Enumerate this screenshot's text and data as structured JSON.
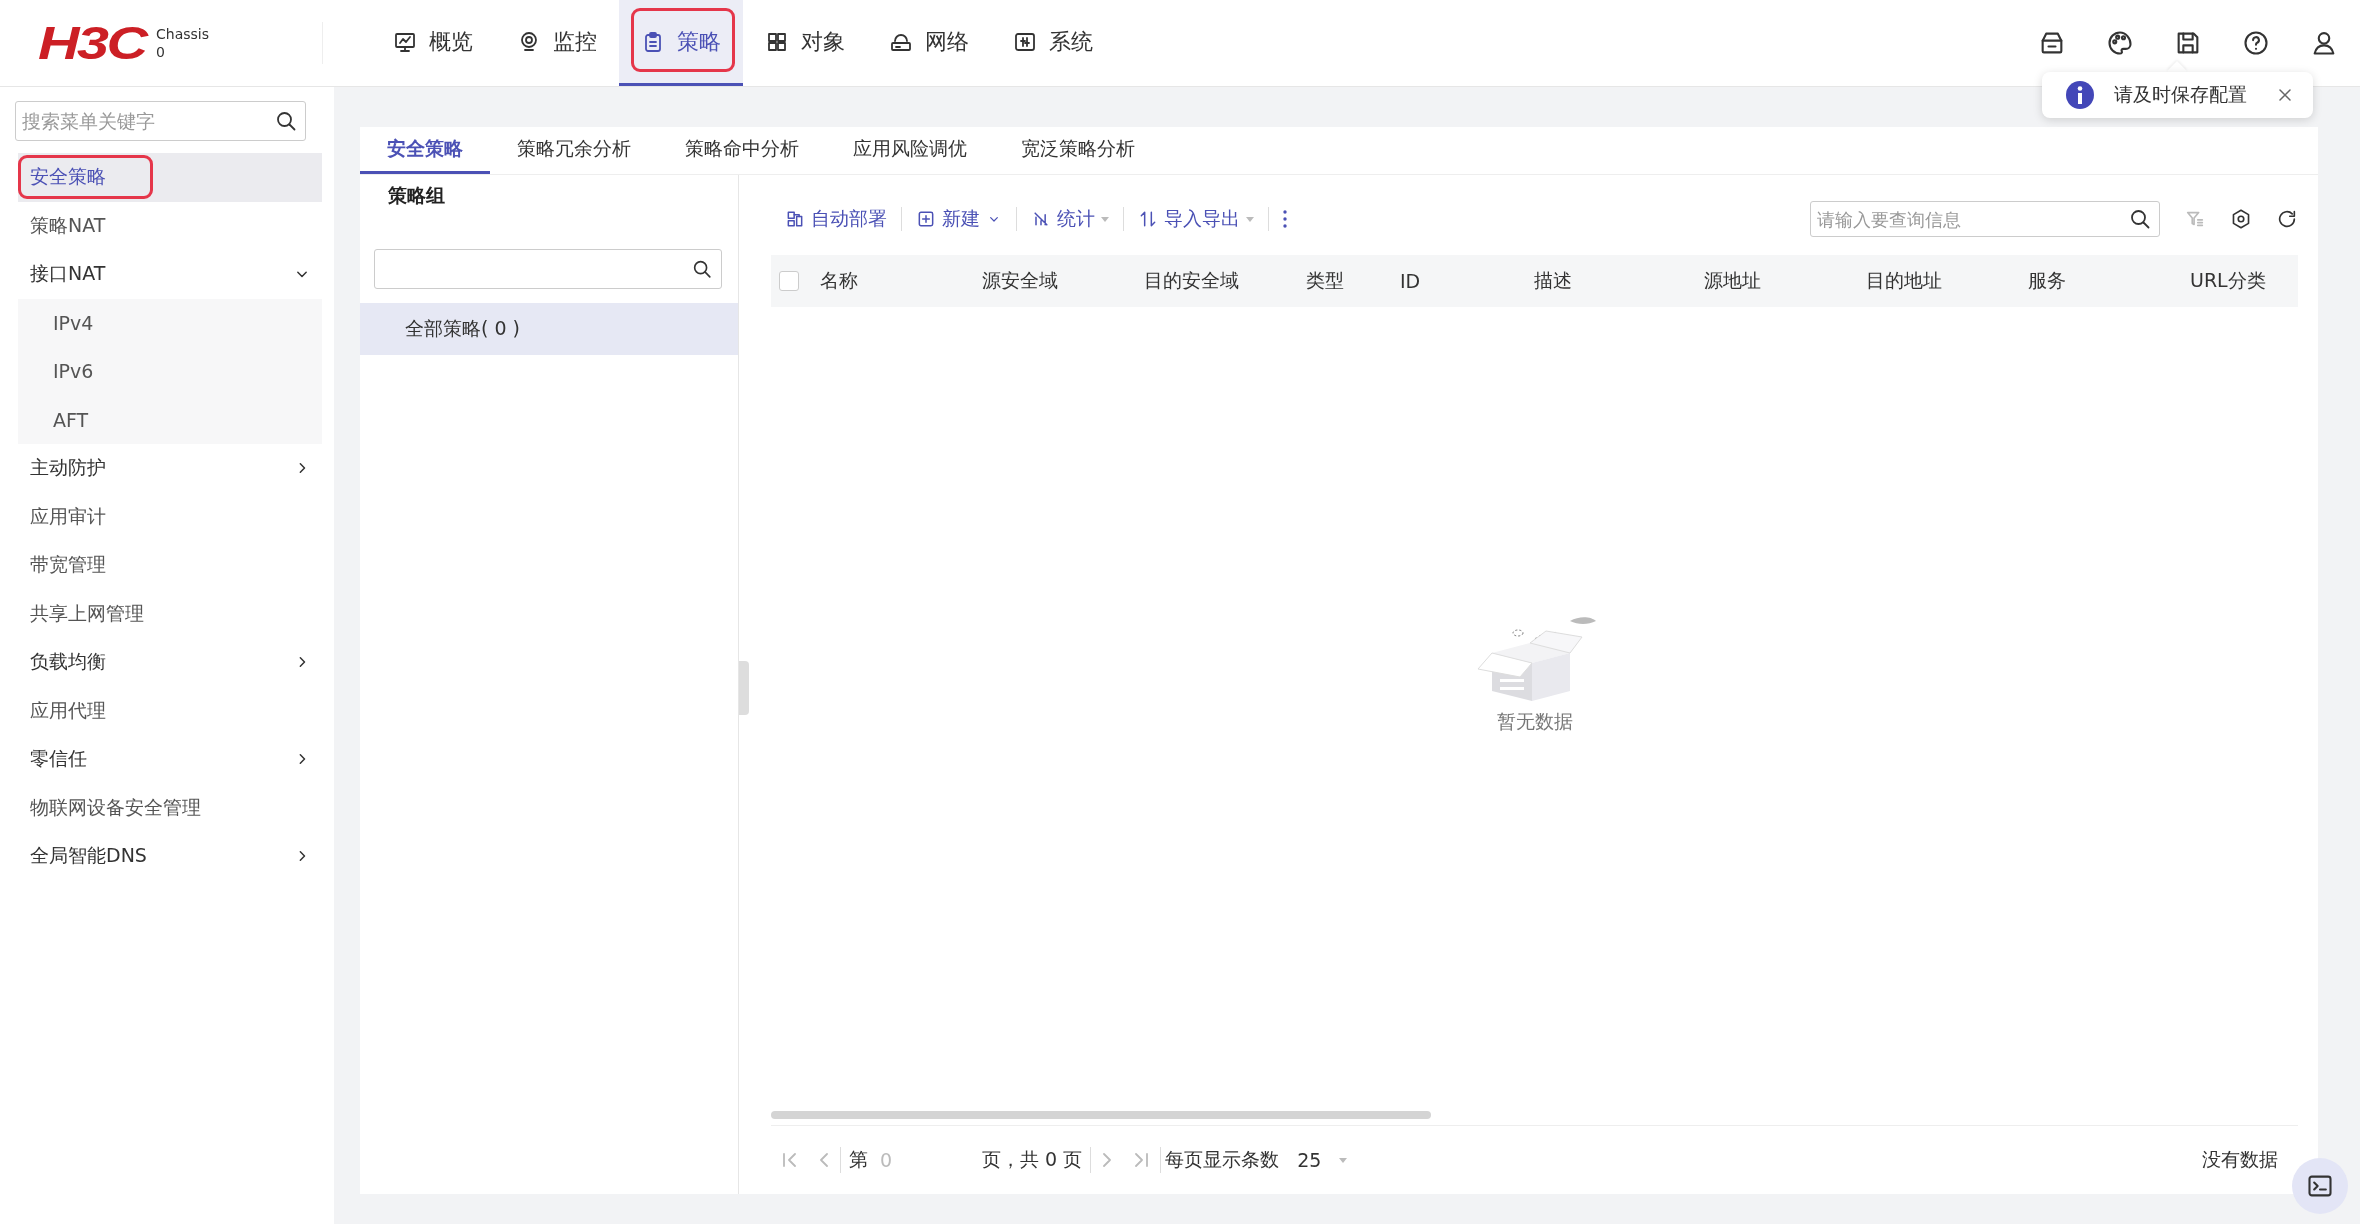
{
  "header": {
    "logo": "H3C",
    "device": {
      "label": "Chassis",
      "value": "0"
    }
  },
  "nav": [
    {
      "label": "概览",
      "selected": false,
      "annotated": false
    },
    {
      "label": "监控",
      "selected": false,
      "annotated": false
    },
    {
      "label": "策略",
      "selected": true,
      "annotated": true
    },
    {
      "label": "对象",
      "selected": false,
      "annotated": false
    },
    {
      "label": "网络",
      "selected": false,
      "annotated": false
    },
    {
      "label": "系统",
      "selected": false,
      "annotated": false
    }
  ],
  "notice": {
    "text": "请及时保存配置"
  },
  "sidebar": {
    "search_placeholder": "搜索菜单关键字",
    "items": [
      {
        "label": "安全策略",
        "kind": "link",
        "selected": true,
        "annotated": true
      },
      {
        "label": "策略NAT",
        "kind": "link",
        "selected": false,
        "annotated": false
      },
      {
        "label": "接口NAT",
        "kind": "group",
        "expanded": true,
        "children": [
          {
            "label": "IPv4",
            "selected": false
          },
          {
            "label": "IPv6",
            "selected": false
          },
          {
            "label": "AFT",
            "selected": false
          }
        ]
      },
      {
        "label": "主动防护",
        "kind": "group",
        "expanded": false
      },
      {
        "label": "应用审计",
        "kind": "link",
        "selected": false,
        "annotated": false
      },
      {
        "label": "带宽管理",
        "kind": "link",
        "selected": false,
        "annotated": false
      },
      {
        "label": "共享上网管理",
        "kind": "link",
        "selected": false,
        "annotated": false
      },
      {
        "label": "负载均衡",
        "kind": "group",
        "expanded": false
      },
      {
        "label": "应用代理",
        "kind": "link",
        "selected": false,
        "annotated": false
      },
      {
        "label": "零信任",
        "kind": "group",
        "expanded": false
      },
      {
        "label": "物联网设备安全管理",
        "kind": "link",
        "selected": false,
        "annotated": false
      },
      {
        "label": "全局智能DNS",
        "kind": "group",
        "expanded": false
      }
    ]
  },
  "subtabs": [
    {
      "label": "安全策略",
      "selected": true
    },
    {
      "label": "策略冗余分析",
      "selected": false
    },
    {
      "label": "策略命中分析",
      "selected": false
    },
    {
      "label": "应用风险调优",
      "selected": false
    },
    {
      "label": "宽泛策略分析",
      "selected": false
    }
  ],
  "group_panel": {
    "title": "策略组",
    "items": [
      {
        "label": "全部策略( 0 )",
        "selected": true
      }
    ]
  },
  "toolbar": [
    {
      "label": "自动部署",
      "kind": "button"
    },
    {
      "label": "新建",
      "kind": "menu"
    },
    {
      "label": "统计",
      "kind": "split"
    },
    {
      "label": "导入导出",
      "kind": "split"
    },
    {
      "kind": "more"
    }
  ],
  "search": {
    "placeholder": "请输入要查询信息"
  },
  "table": {
    "select_all": {
      "checked": false
    },
    "columns": [
      "名称",
      "源安全域",
      "目的安全域",
      "类型",
      "ID",
      "描述",
      "源地址",
      "目的地址",
      "服务",
      "URL分类"
    ],
    "empty_text": "暂无数据"
  },
  "pagination": {
    "page_label": "第",
    "page": "0",
    "total": "页，共 0 页",
    "per_page_label": "每页显示条数",
    "per_page": "25",
    "status": "没有数据"
  }
}
